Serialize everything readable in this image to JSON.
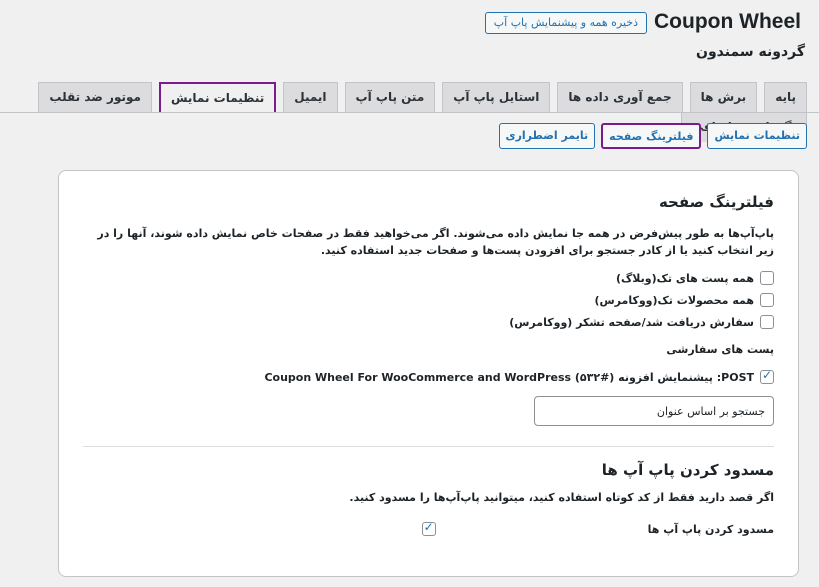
{
  "header": {
    "app_title": "Coupon Wheel",
    "save_preview_label": "ذخیره همه و پیشنمایش پاپ آپ"
  },
  "subtitle": "گردونه سمندون",
  "tabs": [
    {
      "label": "پایه",
      "active": false
    },
    {
      "label": "برش ها",
      "active": false
    },
    {
      "label": "جمع آوری داده ها",
      "active": false
    },
    {
      "label": "استایل پاپ آپ",
      "active": false
    },
    {
      "label": "متن پاپ آپ",
      "active": false
    },
    {
      "label": "ایمیل",
      "active": false
    },
    {
      "label": "تنظیمات نمایش",
      "active": true
    },
    {
      "label": "موتور ضد تقلب",
      "active": false
    },
    {
      "label": "نگهداری و اضافی",
      "active": false
    }
  ],
  "subtabs": [
    {
      "label": "تنظیمات نمایش",
      "active": false
    },
    {
      "label": "فیلترینگ صفحه",
      "active": true
    },
    {
      "label": "تایمر اضطراری",
      "active": false
    }
  ],
  "filtering": {
    "title": "فیلترینگ صفحه",
    "description": "پاپ‌آپ‌ها به طور پیش‌فرض در همه جا نمایش داده می‌شوند. اگر می‌خواهید فقط در صفحات خاص نمایش داده شوند، آنها را در زیر انتخاب کنید یا از کادر جستجو برای افزودن پست‌ها و صفحات جدید استفاده کنید.",
    "options": [
      {
        "label": "همه پست های تک(وبلاگ)",
        "checked": false
      },
      {
        "label": "همه محصولات تک(ووکامرس)",
        "checked": false
      },
      {
        "label": "سفارش دریافت شد/صفحه تشکر (ووکامرس)",
        "checked": false
      }
    ],
    "custom_posts_label": "پست های سفارشی",
    "custom_post": {
      "label": "POST: پیشنمایش افزونه (#۵۳۲) Coupon Wheel For WooCommerce and WordPress",
      "checked": true
    },
    "search_placeholder": "جستجو بر اساس عنوان"
  },
  "blocking": {
    "title": "مسدود کردن پاپ آپ ها",
    "description": "اگر قصد دارید فقط از کد کوتاه استفاده کنید، میتوانید پاپ‌آپ‌ها را مسدود کنید.",
    "toggle_label": "مسدود کردن پاپ آپ ها",
    "checked": true
  },
  "colors": {
    "accent": "#2271b1",
    "highlight": "#7a1b8f"
  }
}
